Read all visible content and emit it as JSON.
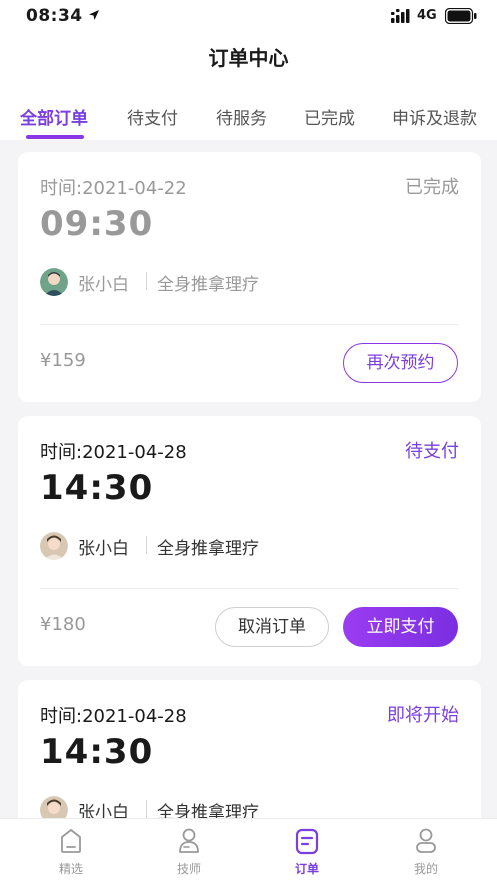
{
  "status_bar": {
    "time": "08:34",
    "network": "4G"
  },
  "header": {
    "title": "订单中心"
  },
  "tabs": [
    {
      "label": "全部订单",
      "active": true
    },
    {
      "label": "待支付",
      "active": false
    },
    {
      "label": "待服务",
      "active": false
    },
    {
      "label": "已完成",
      "active": false
    },
    {
      "label": "申诉及退款",
      "active": false
    }
  ],
  "orders": [
    {
      "time_label": "时间:2021-04-22",
      "status": "已完成",
      "start_time": "09:30",
      "technician": "张小白",
      "service": "全身推拿理疗",
      "price": "¥159",
      "buttons": [
        "再次预约"
      ]
    },
    {
      "time_label": "时间:2021-04-28",
      "status": "待支付",
      "start_time": "14:30",
      "technician": "张小白",
      "service": "全身推拿理疗",
      "price": "¥180",
      "buttons": [
        "取消订单",
        "立即支付"
      ]
    },
    {
      "time_label": "时间:2021-04-28",
      "status": "即将开始",
      "start_time": "14:30",
      "technician": "张小白",
      "service": "全身推拿理疗"
    }
  ],
  "bottom_nav": [
    {
      "label": "精选",
      "icon": "home-icon",
      "active": false
    },
    {
      "label": "技师",
      "icon": "technician-icon",
      "active": false
    },
    {
      "label": "订单",
      "icon": "order-icon",
      "active": true
    },
    {
      "label": "我的",
      "icon": "profile-icon",
      "active": false
    }
  ],
  "colors": {
    "accent": "#7b3fe0",
    "muted": "#999999",
    "background": "#f4f4f6"
  }
}
